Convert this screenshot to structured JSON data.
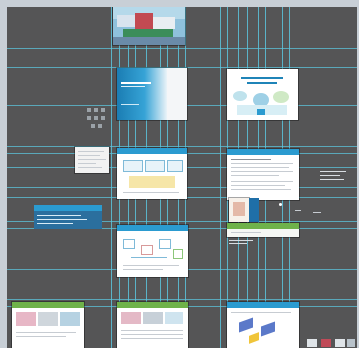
{
  "document": {
    "pages": [
      {
        "id": "cover-photo",
        "kind": "photo"
      },
      {
        "id": "blue-title-page",
        "kind": "title",
        "title": "",
        "subtitle": ""
      },
      {
        "id": "illustrated-title-page",
        "kind": "title",
        "title": "",
        "subtitle": ""
      },
      {
        "id": "flow-page",
        "kind": "content",
        "header": ""
      },
      {
        "id": "text-page",
        "kind": "content",
        "header": ""
      },
      {
        "id": "diagram-page",
        "kind": "content",
        "header": ""
      },
      {
        "id": "green-header-page",
        "kind": "content",
        "header": ""
      },
      {
        "id": "green-photo-page",
        "kind": "content",
        "header": ""
      },
      {
        "id": "green-table-page",
        "kind": "content",
        "header": ""
      },
      {
        "id": "isometric-page",
        "kind": "content",
        "header": ""
      }
    ],
    "floating_items": [
      {
        "id": "small-icon-grid",
        "kind": "icons"
      },
      {
        "id": "note-card",
        "kind": "text"
      },
      {
        "id": "blue-banner",
        "kind": "banner",
        "text": ""
      },
      {
        "id": "pasteboard-caption",
        "kind": "text",
        "text": ""
      },
      {
        "id": "small-brochure-thumb",
        "kind": "image"
      },
      {
        "id": "bottom-right-thumbnails",
        "kind": "images"
      }
    ]
  },
  "colors": {
    "pasteboard": "#555556",
    "frame": "#c8cfd6",
    "guide": "#5cc4dc",
    "header_blue": "#2b9bd0",
    "header_green": "#6fb24a",
    "title_blue": "#1f84b8"
  }
}
